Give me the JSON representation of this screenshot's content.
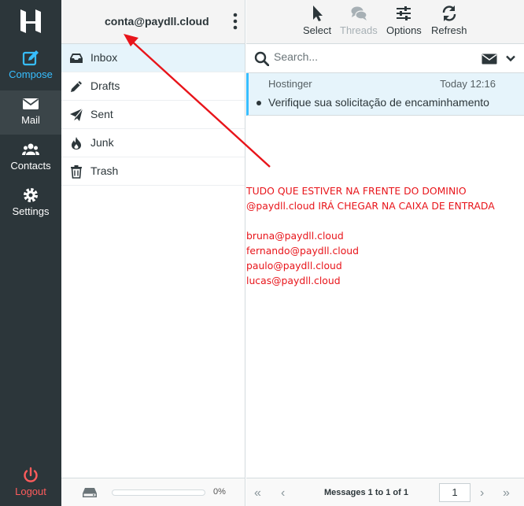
{
  "rail": {
    "compose_label": "Compose",
    "mail_label": "Mail",
    "contacts_label": "Contacts",
    "settings_label": "Settings",
    "logout_label": "Logout"
  },
  "account": {
    "email": "conta@paydll.cloud"
  },
  "folders": [
    {
      "label": "Inbox",
      "icon": "inbox-icon"
    },
    {
      "label": "Drafts",
      "icon": "pencil-icon"
    },
    {
      "label": "Sent",
      "icon": "paper-plane-icon"
    },
    {
      "label": "Junk",
      "icon": "fire-icon"
    },
    {
      "label": "Trash",
      "icon": "trash-icon"
    }
  ],
  "quota": {
    "text": "0%",
    "fraction": 0
  },
  "toolbar": {
    "select_label": "Select",
    "threads_label": "Threads",
    "options_label": "Options",
    "refresh_label": "Refresh"
  },
  "search": {
    "placeholder": "Search..."
  },
  "messages": [
    {
      "from": "Hostinger",
      "date": "Today 12:16",
      "subject": "Verifique sua solicitação de encaminhamento"
    }
  ],
  "pagination": {
    "count_text": "Messages 1 to 1 of 1",
    "page": "1"
  },
  "annotation": {
    "lines": [
      "TUDO QUE ESTIVER NA FRENTE DO DOMINIO",
      "@paydll.cloud IRÁ CHEGAR NA CAIXA DE ENTRADA",
      "",
      "bruna@paydll.cloud",
      "fernando@paydll.cloud",
      "paulo@paydll.cloud",
      "lucas@paydll.cloud"
    ],
    "color": "#e8141a"
  },
  "colors": {
    "accent": "#37beff",
    "rail": "#2c363a",
    "logout": "#ff5c5c"
  }
}
